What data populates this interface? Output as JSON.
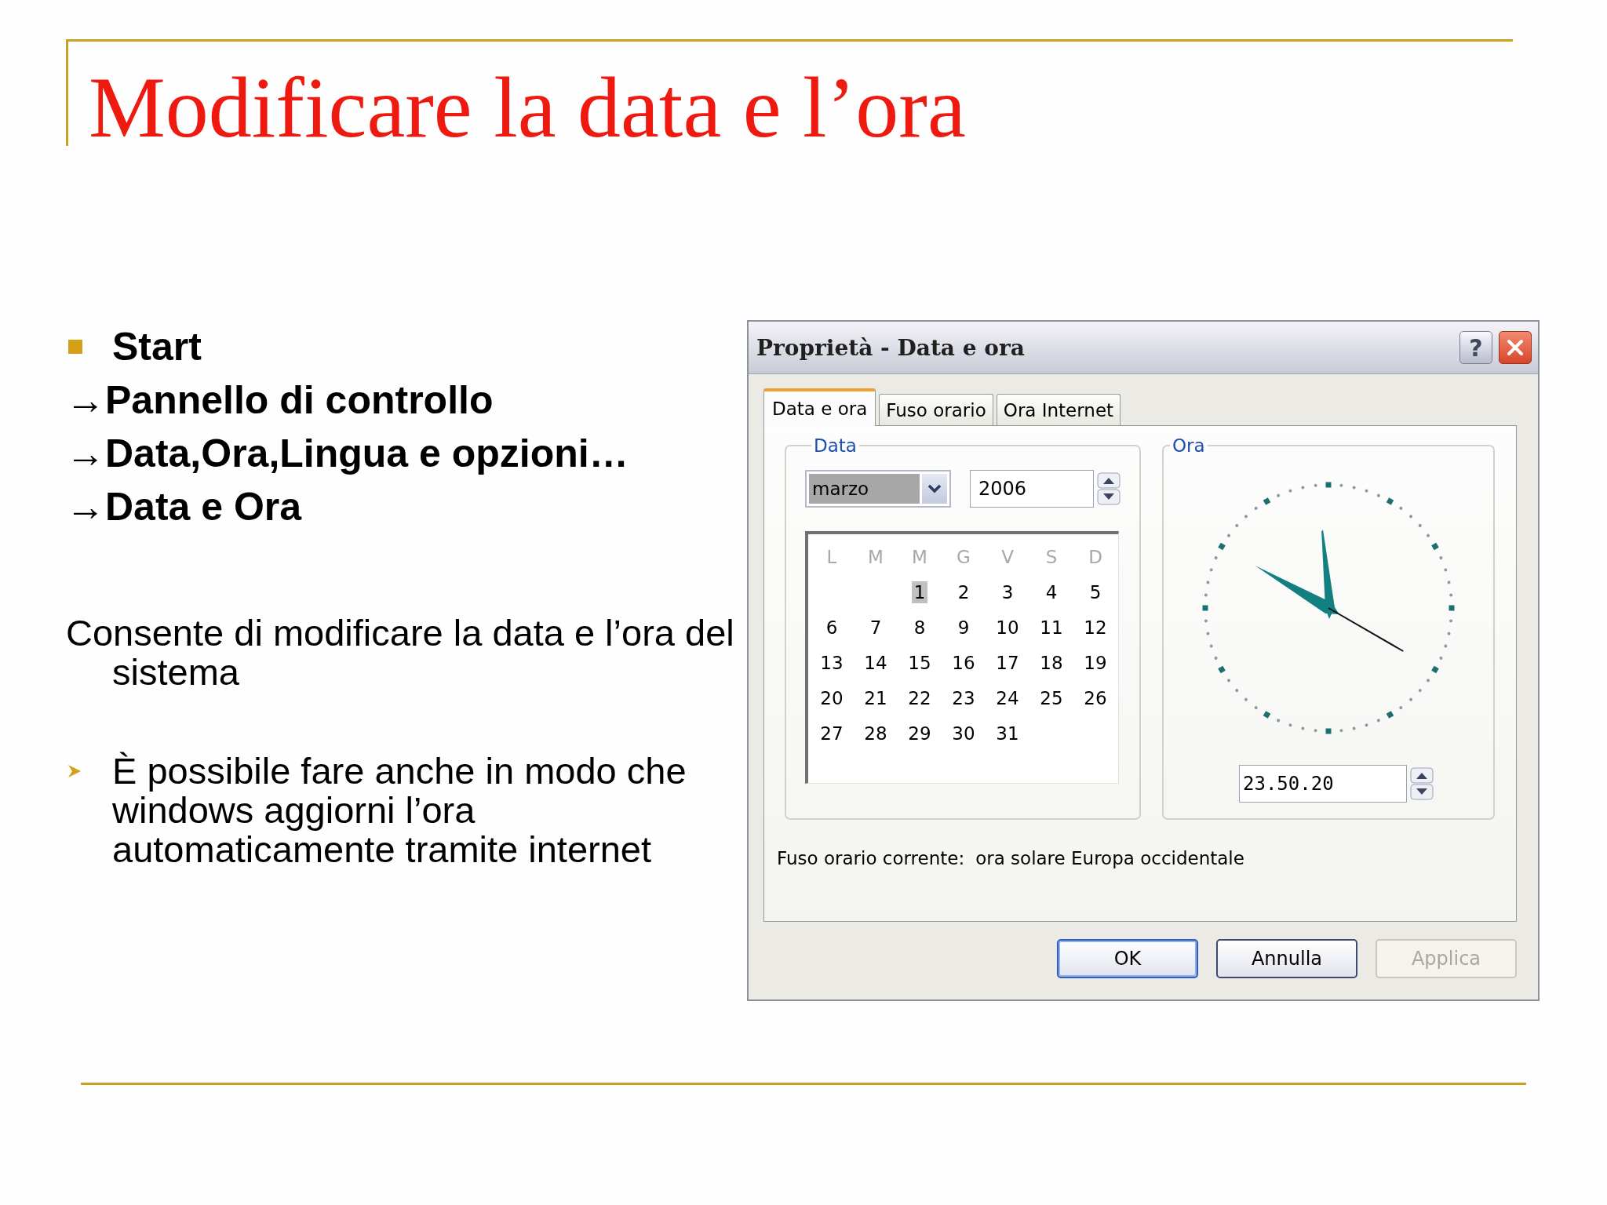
{
  "slide": {
    "title": "Modificare la data e l’ora",
    "steps": [
      {
        "kind": "bullet",
        "text": "Start"
      },
      {
        "kind": "arrow",
        "text": "→Pannello di controllo"
      },
      {
        "kind": "arrow",
        "text": "→Data,Ora,Lingua e opzioni…"
      },
      {
        "kind": "arrow",
        "text": "→Data e Ora"
      }
    ],
    "paragraphs": [
      {
        "kind": "plain",
        "text": "Consente di modificare la data e l’ora del sistema"
      },
      {
        "kind": "arrow_bullet",
        "text": "È possibile fare anche in modo che windows aggiorni l’ora automaticamente tramite internet"
      }
    ]
  },
  "dialog": {
    "title": "Proprietà - Data e ora",
    "help": "?",
    "tabs": [
      {
        "label": "Data e ora",
        "selected": true
      },
      {
        "label": "Fuso orario",
        "selected": false
      },
      {
        "label": "Ora Internet",
        "selected": false
      }
    ],
    "date": {
      "label": "Data",
      "month": "marzo",
      "year": "2006",
      "weekdays": [
        "L",
        "M",
        "M",
        "G",
        "V",
        "S",
        "D"
      ],
      "weeks": [
        {
          "days": [
            {
              "day": "1",
              "selected": true
            },
            {
              "day": "2",
              "selected": false
            },
            {
              "day": "3",
              "selected": false
            },
            {
              "day": "4",
              "selected": false
            },
            {
              "day": "5",
              "selected": false
            }
          ]
        },
        {
          "days": [
            {
              "day": "6",
              "selected": false
            },
            {
              "day": "7",
              "selected": false
            },
            {
              "day": "8",
              "selected": false
            },
            {
              "day": "9",
              "selected": false
            },
            {
              "day": "10",
              "selected": false
            },
            {
              "day": "11",
              "selected": false
            },
            {
              "day": "12",
              "selected": false
            }
          ]
        },
        {
          "days": [
            {
              "day": "13",
              "selected": false
            },
            {
              "day": "14",
              "selected": false
            },
            {
              "day": "15",
              "selected": false
            },
            {
              "day": "16",
              "selected": false
            },
            {
              "day": "17",
              "selected": false
            },
            {
              "day": "18",
              "selected": false
            },
            {
              "day": "19",
              "selected": false
            }
          ]
        },
        {
          "days": [
            {
              "day": "20",
              "selected": false
            },
            {
              "day": "21",
              "selected": false
            },
            {
              "day": "22",
              "selected": false
            },
            {
              "day": "23",
              "selected": false
            },
            {
              "day": "24",
              "selected": false
            },
            {
              "day": "25",
              "selected": false
            },
            {
              "day": "26",
              "selected": false
            }
          ]
        },
        {
          "days": [
            {
              "day": "27",
              "selected": false
            },
            {
              "day": "28",
              "selected": false
            },
            {
              "day": "29",
              "selected": false
            },
            {
              "day": "30",
              "selected": false
            },
            {
              "day": "31",
              "selected": false
            }
          ]
        }
      ]
    },
    "time": {
      "label": "Ora",
      "value": "23.50.20"
    },
    "timezone": {
      "label": "Fuso orario corrente:",
      "value": "ora solare Europa occidentale"
    },
    "buttons": [
      {
        "label": "OK",
        "default": true,
        "disabled": false
      },
      {
        "label": "Annulla",
        "default": false,
        "disabled": false
      },
      {
        "label": "Applica",
        "default": false,
        "disabled": true
      }
    ]
  }
}
